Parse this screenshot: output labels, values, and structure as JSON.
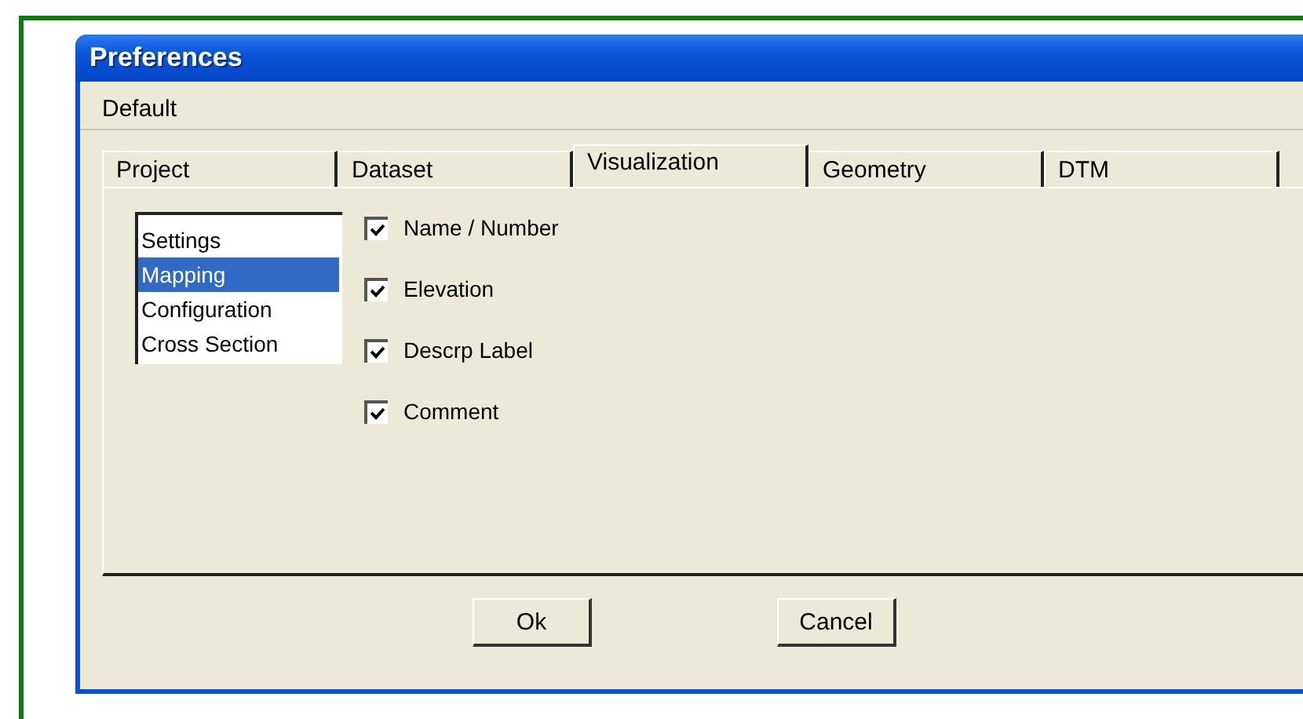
{
  "window": {
    "title": "Preferences"
  },
  "menu": [
    "Default"
  ],
  "tabs": [
    {
      "label": "Project",
      "selected": false
    },
    {
      "label": "Dataset",
      "selected": false
    },
    {
      "label": "Visualization",
      "selected": true
    },
    {
      "label": "Geometry",
      "selected": false
    },
    {
      "label": "DTM",
      "selected": false
    }
  ],
  "list": [
    {
      "label": "Settings",
      "selected": false
    },
    {
      "label": "Mapping",
      "selected": true
    },
    {
      "label": "Configuration",
      "selected": false
    },
    {
      "label": "Cross Section",
      "selected": false
    }
  ],
  "options": [
    {
      "label": "Name / Number",
      "checked": true
    },
    {
      "label": "Elevation",
      "checked": true
    },
    {
      "label": "Descrp Label",
      "checked": true
    },
    {
      "label": "Comment",
      "checked": true
    }
  ],
  "buttons": [
    "Ok",
    "Cancel"
  ]
}
